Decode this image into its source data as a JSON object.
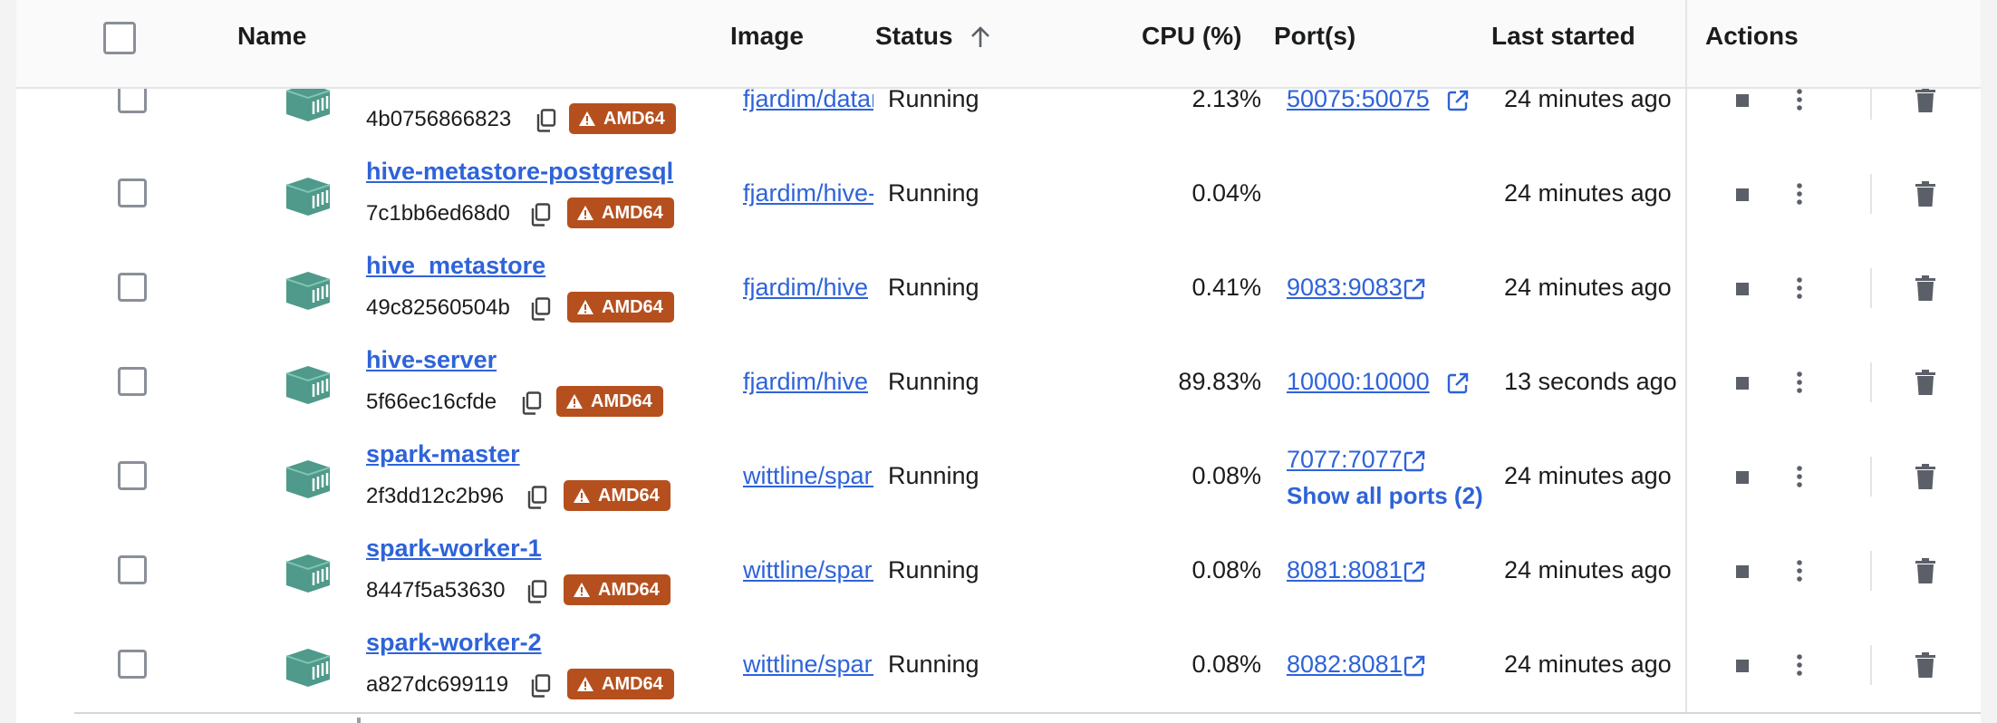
{
  "header": {
    "name": "Name",
    "image": "Image",
    "status": "Status",
    "cpu": "CPU (%)",
    "ports": "Port(s)",
    "last_started": "Last started",
    "actions": "Actions"
  },
  "rows": [
    {
      "name": "",
      "id": "4b0756866823",
      "arch": "AMD64",
      "image": "fjardim/datanode",
      "status": "Running",
      "cpu": "2.13%",
      "port": "50075:50075",
      "last_started": "24 minutes ago"
    },
    {
      "name": "hive-metastore-postgresql",
      "id": "7c1bb6ed68d0",
      "arch": "AMD64",
      "image": "fjardim/hive-metastore",
      "status": "Running",
      "cpu": "0.04%",
      "port": "",
      "last_started": "24 minutes ago"
    },
    {
      "name": "hive_metastore",
      "id": "49c82560504b",
      "arch": "AMD64",
      "image": "fjardim/hive",
      "status": "Running",
      "cpu": "0.41%",
      "port": "9083:9083",
      "last_started": "24 minutes ago"
    },
    {
      "name": "hive-server",
      "id": "5f66ec16cfde",
      "arch": "AMD64",
      "image": "fjardim/hive",
      "status": "Running",
      "cpu": "89.83%",
      "port": "10000:10000",
      "last_started": "13 seconds ago"
    },
    {
      "name": "spark-master",
      "id": "2f3dd12c2b96",
      "arch": "AMD64",
      "image": "wittline/spark",
      "status": "Running",
      "cpu": "0.08%",
      "port": "7077:7077",
      "show_ports": "Show all ports (2)",
      "last_started": "24 minutes ago"
    },
    {
      "name": "spark-worker-1",
      "id": "8447f5a53630",
      "arch": "AMD64",
      "image": "wittline/spark",
      "status": "Running",
      "cpu": "0.08%",
      "port": "8081:8081",
      "last_started": "24 minutes ago"
    },
    {
      "name": "spark-worker-2",
      "id": "a827dc699119",
      "arch": "AMD64",
      "image": "wittline/spark",
      "status": "Running",
      "cpu": "0.08%",
      "port": "8082:8081",
      "last_started": "24 minutes ago"
    }
  ],
  "icons": {
    "container": "container-icon",
    "copy": "copy-icon",
    "warning": "warning-icon",
    "external_link": "external-link-icon",
    "stop": "stop-icon",
    "more": "more-vertical-icon",
    "delete": "trash-icon",
    "sort": "arrow-up-icon"
  },
  "colors": {
    "link": "#2e63d9",
    "badge": "#b5501e",
    "container_icon": "#4f9a8a",
    "action_icon": "#5b6068"
  }
}
